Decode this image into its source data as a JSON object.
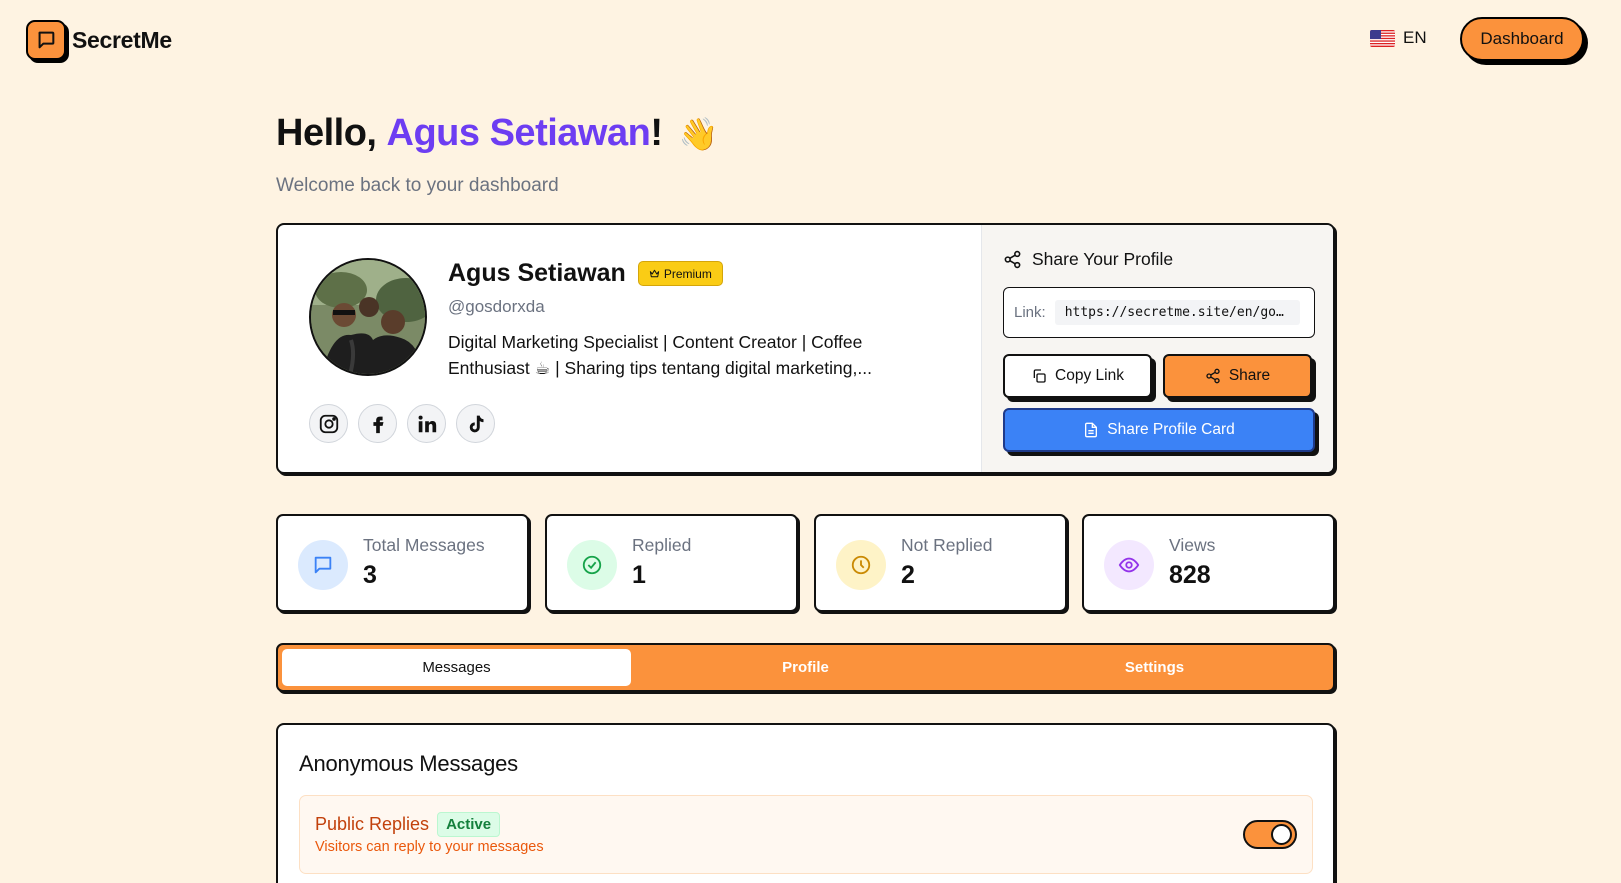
{
  "header": {
    "brand": "SecretMe",
    "language": "EN",
    "dashboard_label": "Dashboard"
  },
  "greeting": {
    "prefix": "Hello, ",
    "name": "Agus Setiawan",
    "suffix": "!",
    "emoji": "👋",
    "subtitle": "Welcome back to your dashboard"
  },
  "profile": {
    "name": "Agus Setiawan",
    "badge": "Premium",
    "handle": "@gosdorxda",
    "bio_line1": "Digital Marketing Specialist | Content Creator | Coffee",
    "bio_line2": "Enthusiast ☕ | Sharing tips tentang digital marketing,...",
    "socials": [
      "instagram-icon",
      "facebook-icon",
      "linkedin-icon",
      "tiktok-icon"
    ]
  },
  "share": {
    "title": "Share Your Profile",
    "link_label": "Link:",
    "link_url": "https://secretme.site/en/gosdorxda",
    "copy_label": "Copy Link",
    "share_label": "Share",
    "card_label": "Share Profile Card"
  },
  "stats": [
    {
      "label": "Total Messages",
      "value": "3",
      "icon": "message-icon",
      "color": "#3b82f6"
    },
    {
      "label": "Replied",
      "value": "1",
      "icon": "check-circle-icon",
      "color": "#16a34a"
    },
    {
      "label": "Not Replied",
      "value": "2",
      "icon": "clock-icon",
      "color": "#ca8a04"
    },
    {
      "label": "Views",
      "value": "828",
      "icon": "eye-icon",
      "color": "#9333ea"
    }
  ],
  "tabs": [
    {
      "label": "Messages",
      "active": true
    },
    {
      "label": "Profile",
      "active": false
    },
    {
      "label": "Settings",
      "active": false
    }
  ],
  "messages": {
    "title": "Anonymous Messages",
    "public_replies": {
      "title": "Public Replies",
      "status": "Active",
      "description": "Visitors can reply to your messages",
      "enabled": true
    }
  },
  "colors": {
    "accent": "#fb923c",
    "brand_purple": "#6d3df2",
    "background": "#fef3e2",
    "primary_blue": "#3b82f6"
  }
}
